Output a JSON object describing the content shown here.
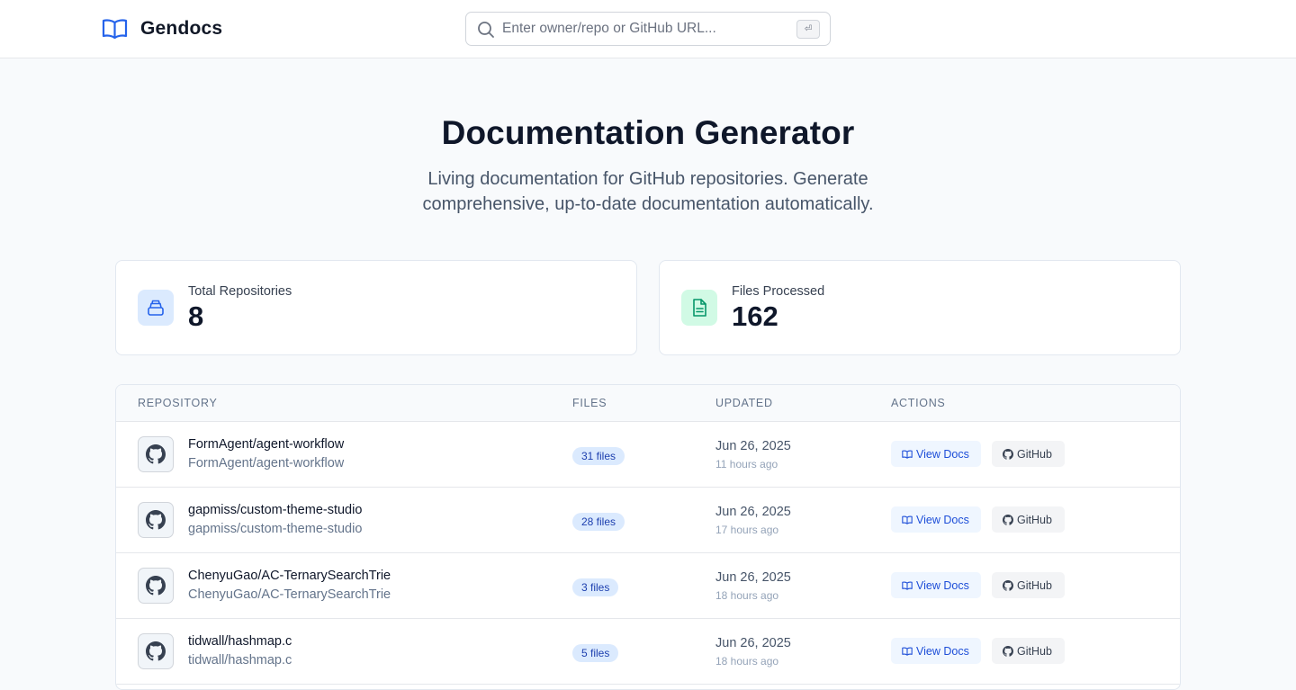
{
  "header": {
    "brand": "Gendocs",
    "search_placeholder": "Enter owner/repo or GitHub URL...",
    "search_kbd": "⏎"
  },
  "hero": {
    "title": "Documentation Generator",
    "subtitle": "Living documentation for GitHub repositories. Generate comprehensive, up-to-date documentation automatically."
  },
  "stats": {
    "repos_label": "Total Repositories",
    "repos_value": "8",
    "files_label": "Files Processed",
    "files_value": "162"
  },
  "table": {
    "headers": {
      "repository": "REPOSITORY",
      "files": "FILES",
      "updated": "UPDATED",
      "actions": "ACTIONS"
    },
    "view_docs_label": "View Docs",
    "github_label": "GitHub",
    "rows": [
      {
        "name": "FormAgent/agent-workflow",
        "path": "FormAgent/agent-workflow",
        "files": "31 files",
        "date": "Jun 26, 2025",
        "ago": "11 hours ago"
      },
      {
        "name": "gapmiss/custom-theme-studio",
        "path": "gapmiss/custom-theme-studio",
        "files": "28 files",
        "date": "Jun 26, 2025",
        "ago": "17 hours ago"
      },
      {
        "name": "ChenyuGao/AC-TernarySearchTrie",
        "path": "ChenyuGao/AC-TernarySearchTrie",
        "files": "3 files",
        "date": "Jun 26, 2025",
        "ago": "18 hours ago"
      },
      {
        "name": "tidwall/hashmap.c",
        "path": "tidwall/hashmap.c",
        "files": "5 files",
        "date": "Jun 26, 2025",
        "ago": "18 hours ago"
      }
    ]
  },
  "colors": {
    "accent": "#2563eb",
    "badge_bg": "#dbeafe",
    "success_bg": "#d1fae5",
    "success": "#059669"
  }
}
